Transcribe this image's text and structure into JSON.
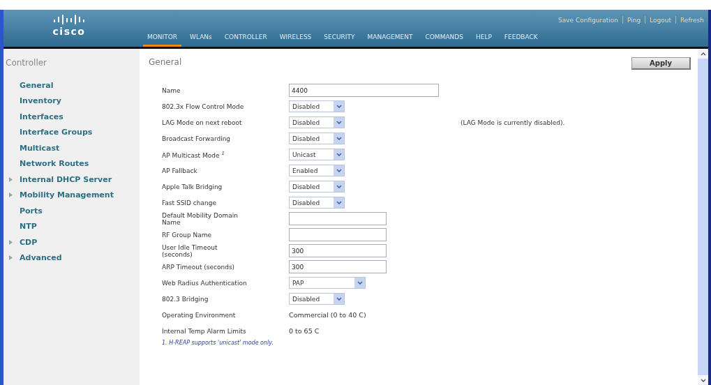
{
  "header": {
    "logo_text": "cisco",
    "top_links": [
      {
        "label": "Save Configuration"
      },
      {
        "label": "Ping"
      },
      {
        "label": "Logout"
      },
      {
        "label": "Refresh"
      }
    ],
    "nav": [
      {
        "label": "MONITOR",
        "selected": true
      },
      {
        "label": "WLANs",
        "selected": false
      },
      {
        "label": "CONTROLLER",
        "selected": false
      },
      {
        "label": "WIRELESS",
        "selected": false
      },
      {
        "label": "SECURITY",
        "selected": false
      },
      {
        "label": "MANAGEMENT",
        "selected": false
      },
      {
        "label": "COMMANDS",
        "selected": false
      },
      {
        "label": "HELP",
        "selected": false
      },
      {
        "label": "FEEDBACK",
        "selected": false
      }
    ]
  },
  "sidebar": {
    "title": "Controller",
    "items": [
      {
        "label": "General",
        "collapsible": false
      },
      {
        "label": "Inventory",
        "collapsible": false
      },
      {
        "label": "Interfaces",
        "collapsible": false
      },
      {
        "label": "Interface Groups",
        "collapsible": false
      },
      {
        "label": "Multicast",
        "collapsible": false
      },
      {
        "label": "Network Routes",
        "collapsible": false
      },
      {
        "label": "Internal DHCP Server",
        "collapsible": true
      },
      {
        "label": "Mobility Management",
        "collapsible": true
      },
      {
        "label": "Ports",
        "collapsible": false
      },
      {
        "label": "NTP",
        "collapsible": false
      },
      {
        "label": "CDP",
        "collapsible": true
      },
      {
        "label": "Advanced",
        "collapsible": true
      }
    ]
  },
  "page": {
    "title": "General",
    "apply_button": "Apply",
    "fields": [
      {
        "label": "Name",
        "kind": "longtext",
        "value": "4400"
      },
      {
        "label": "802.3x Flow Control Mode",
        "kind": "select",
        "value": "Disabled"
      },
      {
        "label": "LAG Mode on next reboot",
        "kind": "select",
        "value": "Disabled",
        "note": "(LAG Mode is currently disabled)."
      },
      {
        "label": "Broadcast Forwarding",
        "kind": "select",
        "value": "Disabled"
      },
      {
        "label": "AP Multicast Mode $^{1}$",
        "kind": "select",
        "value": "Unicast"
      },
      {
        "label": "AP Fallback",
        "kind": "select",
        "value": "Enabled"
      },
      {
        "label": "Apple Talk Bridging",
        "kind": "select",
        "value": "Disabled"
      },
      {
        "label": "Fast SSID change",
        "kind": "select",
        "value": "Disabled"
      },
      {
        "label": "Default Mobility Domain Name",
        "kind": "text"
      },
      {
        "label": "RF Group Name",
        "kind": "text"
      },
      {
        "label": "User Idle Timeout (seconds)",
        "kind": "text",
        "value": "300"
      },
      {
        "label": "ARP Timeout (seconds)",
        "kind": "text",
        "value": "300"
      },
      {
        "label": "Web Radius Authentication",
        "kind": "longselect",
        "value": "PAP"
      },
      {
        "label": "802.3 Bridging",
        "kind": "select",
        "value": "Disabled"
      },
      {
        "label": "Operating Environment",
        "kind": "static",
        "value": "Commercial (0 to 40 C)"
      },
      {
        "label": "Internal Temp Alarm Limits",
        "kind": "static",
        "value": "0 to 65 C"
      }
    ],
    "footnote": "1. H-REAP supports 'unicast' mode only."
  }
}
